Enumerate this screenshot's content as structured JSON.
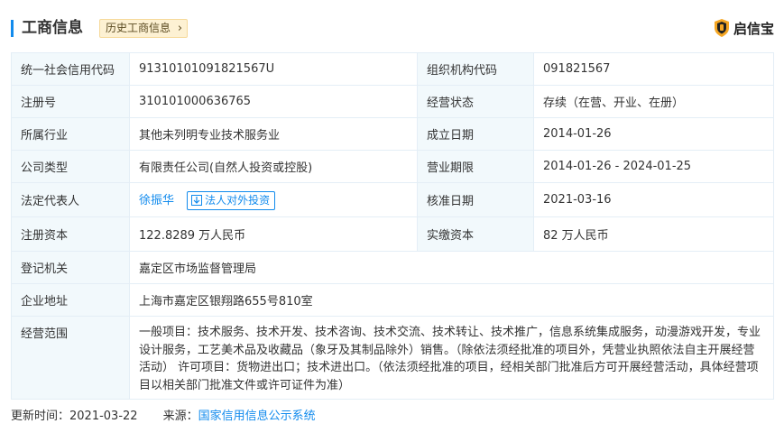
{
  "header": {
    "title": "工商信息",
    "history_button": "历史工商信息",
    "brand": "启信宝"
  },
  "rows": [
    {
      "l1": "统一社会信用代码",
      "v1": "91310101091821567U",
      "l2": "组织机构代码",
      "v2": "091821567"
    },
    {
      "l1": "注册号",
      "v1": "310101000636765",
      "l2": "经营状态",
      "v2": "存续（在营、开业、在册）"
    },
    {
      "l1": "所属行业",
      "v1": "其他未列明专业技术服务业",
      "l2": "成立日期",
      "v2": "2014-01-26"
    },
    {
      "l1": "公司类型",
      "v1": "有限责任公司(自然人投资或控股)",
      "l2": "营业期限",
      "v2": "2014-01-26 - 2024-01-25"
    },
    {
      "l1": "法定代表人",
      "v1": "徐振华",
      "v1_button": "法人对外投资",
      "l2": "核准日期",
      "v2": "2021-03-16"
    },
    {
      "l1": "注册资本",
      "v1": "122.8289 万人民币",
      "l2": "实缴资本",
      "v2": "82 万人民币"
    },
    {
      "l1": "登记机关",
      "v1": "嘉定区市场监督管理局"
    },
    {
      "l1": "企业地址",
      "v1": "上海市嘉定区银翔路655号810室"
    },
    {
      "l1": "经营范围",
      "v1": "一般项目：技术服务、技术开发、技术咨询、技术交流、技术转让、技术推广，信息系统集成服务，动漫游戏开发，专业设计服务，工艺美术品及收藏品（象牙及其制品除外）销售。（除依法须经批准的项目外，凭营业执照依法自主开展经营活动） 许可项目：货物进出口；技术进出口。（依法须经批准的项目，经相关部门批准后方可开展经营活动，具体经营项目以相关部门批准文件或许可证件为准）"
    }
  ],
  "footer": {
    "updated_label": "更新时间：",
    "updated_value": "2021-03-22",
    "source_label": "来源：",
    "source_value": "国家信用信息公示系统"
  },
  "colors": {
    "accent": "#128bed",
    "label_bg": "#f2f9fc",
    "border": "#e4eef6",
    "history_bg": "#fdf1d3",
    "brand_shield": "#f5a623"
  },
  "icons": [
    "chevron-right-icon",
    "shield-logo-icon",
    "investment-icon"
  ]
}
